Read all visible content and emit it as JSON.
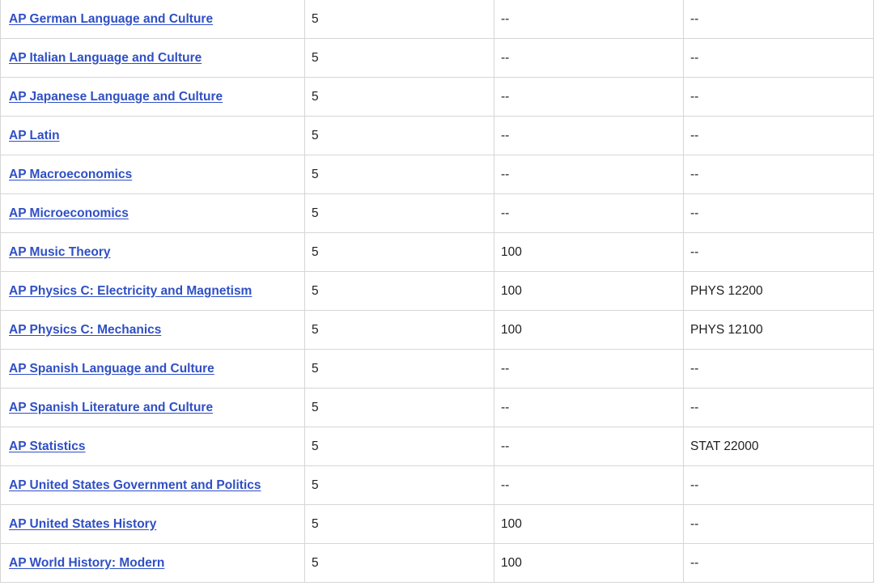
{
  "table": {
    "rows": [
      {
        "course": "AP German Language and Culture",
        "score": "5",
        "credit": "--",
        "equivalent": "--"
      },
      {
        "course": "AP Italian Language and Culture",
        "score": "5",
        "credit": "--",
        "equivalent": "--"
      },
      {
        "course": "AP Japanese Language and Culture",
        "score": "5",
        "credit": "--",
        "equivalent": "--"
      },
      {
        "course": "AP Latin",
        "score": "5",
        "credit": "--",
        "equivalent": "--"
      },
      {
        "course": "AP Macroeconomics",
        "score": "5",
        "credit": "--",
        "equivalent": "--"
      },
      {
        "course": "AP Microeconomics",
        "score": "5",
        "credit": "--",
        "equivalent": "--"
      },
      {
        "course": "AP Music Theory",
        "score": "5",
        "credit": "100",
        "equivalent": "--"
      },
      {
        "course": "AP Physics C: Electricity and Magnetism",
        "score": "5",
        "credit": "100",
        "equivalent": "PHYS 12200"
      },
      {
        "course": "AP Physics C: Mechanics",
        "score": "5",
        "credit": "100",
        "equivalent": "PHYS 12100"
      },
      {
        "course": "AP Spanish Language and Culture",
        "score": "5",
        "credit": "--",
        "equivalent": "--"
      },
      {
        "course": "AP Spanish Literature and Culture",
        "score": "5",
        "credit": "--",
        "equivalent": "--"
      },
      {
        "course": "AP Statistics",
        "score": "5",
        "credit": "--",
        "equivalent": "STAT 22000"
      },
      {
        "course": "AP United States Government and Politics",
        "score": "5",
        "credit": "--",
        "equivalent": "--"
      },
      {
        "course": "AP United States History",
        "score": "5",
        "credit": "100",
        "equivalent": "--"
      },
      {
        "course": "AP World History: Modern",
        "score": "5",
        "credit": "100",
        "equivalent": "--"
      }
    ]
  },
  "colors": {
    "link": "#2f4fc4",
    "border": "#d6d6d6",
    "text": "#1f1f1f"
  }
}
